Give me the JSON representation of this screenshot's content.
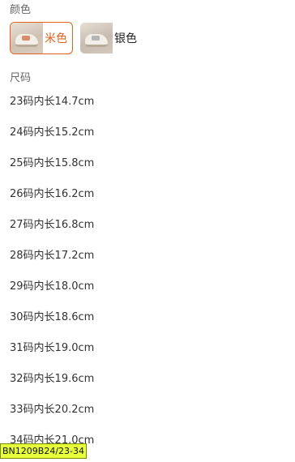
{
  "color_section": {
    "label": "颜色",
    "options": [
      {
        "label": "米色",
        "selected": true,
        "swatch_icon": "beige-shoe-thumbnail"
      },
      {
        "label": "银色",
        "selected": false,
        "swatch_icon": "silver-shoe-thumbnail"
      }
    ]
  },
  "size_section": {
    "label": "尺码",
    "items": [
      "23码内长14.7cm",
      "24码内长15.2cm",
      "25码内长15.8cm",
      "26码内长16.2cm",
      "27码内长16.8cm",
      "28码内长17.2cm",
      "29码内长18.0cm",
      "30码内长18.6cm",
      "31码内长19.0cm",
      "32码内长19.6cm",
      "33码内长20.2cm",
      "34码内长21.0cm"
    ]
  },
  "sku_tag": "BN1209B24/23-34",
  "colors": {
    "accent": "#e0621c",
    "tag_bg": "#e6ff3a"
  }
}
